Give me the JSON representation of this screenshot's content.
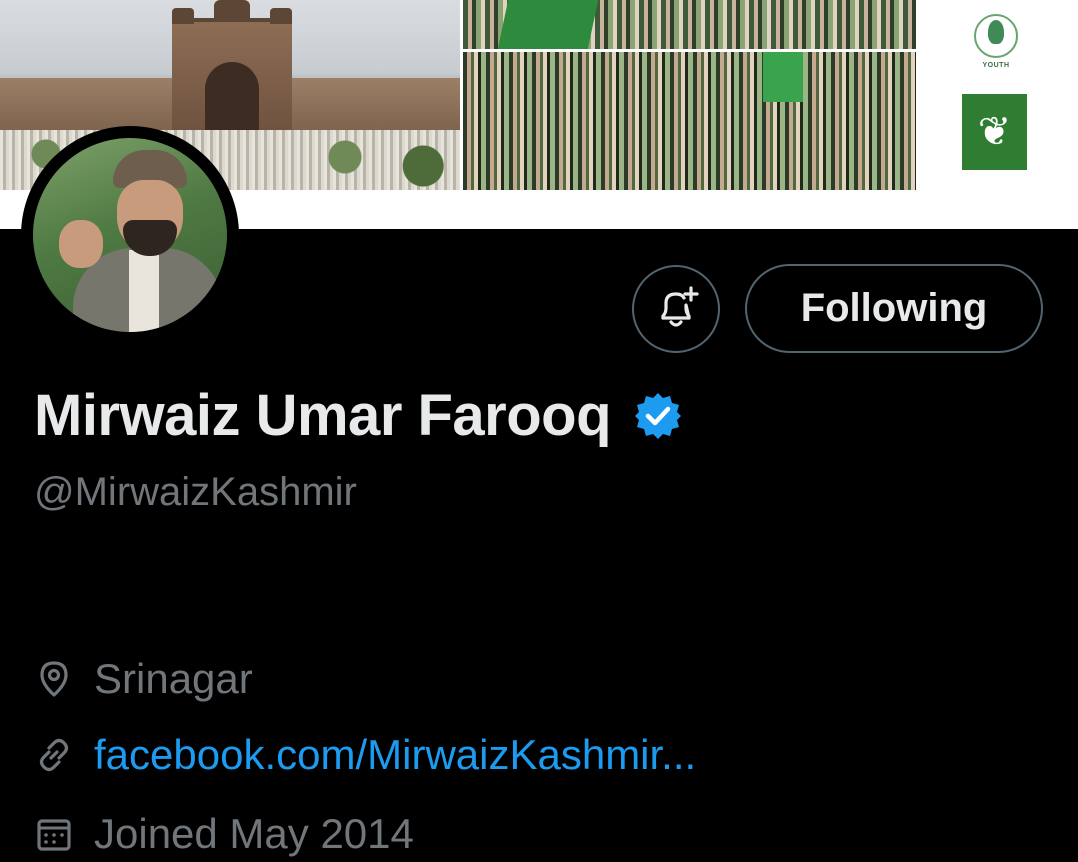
{
  "banner": {
    "logo_youth_text": "YOUTH"
  },
  "profile": {
    "display_name": "Mirwaiz Umar Farooq",
    "handle": "@MirwaizKashmir",
    "verified": true
  },
  "actions": {
    "follow_label": "Following"
  },
  "meta": {
    "location": "Srinagar",
    "website": "facebook.com/MirwaizKashmir...",
    "joined": "Joined May 2014"
  },
  "colors": {
    "background": "#000000",
    "primary_text": "#e7e9ea",
    "secondary_text": "#71767b",
    "link": "#1d9bf0",
    "verified_badge": "#1d9bf0",
    "button_border": "#536471"
  },
  "icons": {
    "notify": "bell-plus-icon",
    "verified": "verified-badge-icon",
    "location": "location-pin-icon",
    "website": "link-icon",
    "joined": "calendar-icon"
  }
}
